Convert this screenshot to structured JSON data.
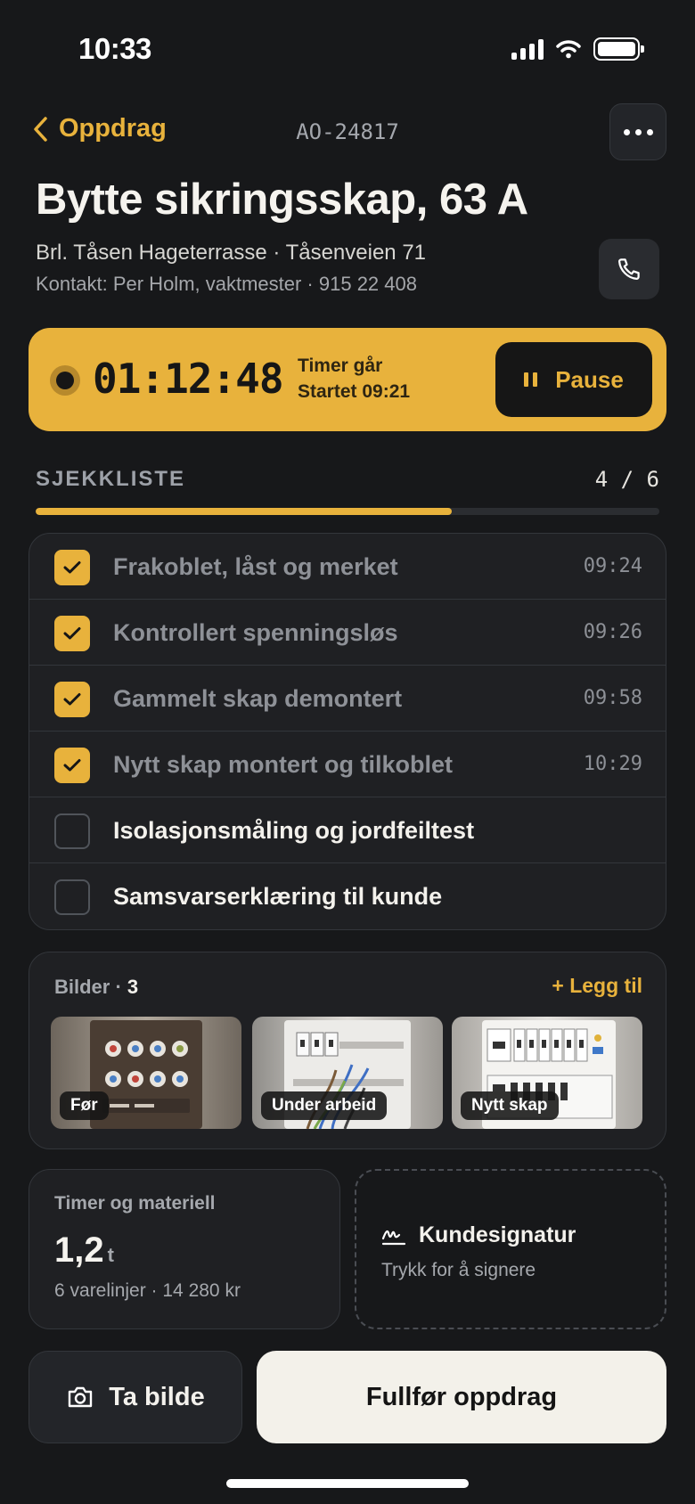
{
  "status_bar": {
    "time": "10:33"
  },
  "nav": {
    "back_label": "Oppdrag",
    "job_id": "AO-24817"
  },
  "job": {
    "title": "Bytte sikringsskap, 63 A",
    "address": "Brl. Tåsen Hageterrasse · Tåsenveien 71",
    "contact": "Kontakt: Per Holm, vaktmester · 915 22 408"
  },
  "timer": {
    "elapsed": "01:12:48",
    "status": "Timer går",
    "started": "Startet 09:21",
    "pause_label": "Pause"
  },
  "checklist": {
    "section_label": "SJEKKLISTE",
    "progress_text": "4 / 6",
    "completed": 4,
    "total": 6,
    "items": [
      {
        "label": "Frakoblet, låst og merket",
        "time": "09:24",
        "done": true
      },
      {
        "label": "Kontrollert spenningsløs",
        "time": "09:26",
        "done": true
      },
      {
        "label": "Gammelt skap demontert",
        "time": "09:58",
        "done": true
      },
      {
        "label": "Nytt skap montert og tilkoblet",
        "time": "10:29",
        "done": true
      },
      {
        "label": "Isolasjonsmåling og jordfeiltest",
        "time": "",
        "done": false
      },
      {
        "label": "Samsvarserklæring til kunde",
        "time": "",
        "done": false
      }
    ]
  },
  "photos": {
    "title": "Bilder ·",
    "count": "3",
    "add_label": "Legg til",
    "items": [
      {
        "tag": "Før"
      },
      {
        "tag": "Under arbeid"
      },
      {
        "tag": "Nytt skap"
      }
    ]
  },
  "materials": {
    "title": "Timer og materiell",
    "hours": "1,2",
    "unit": "t",
    "summary": "6 varelinjer · 14 280 kr"
  },
  "signature": {
    "title": "Kundesignatur",
    "hint": "Trykk for å signere"
  },
  "actions": {
    "camera_label": "Ta bilde",
    "finish_label": "Fullfør oppdrag"
  },
  "colors": {
    "accent": "#e8b23c",
    "background": "#17181a",
    "card": "#1f2023",
    "finish_button": "#f3f1ea"
  },
  "icons": [
    "chevron-left-icon",
    "more-icon",
    "phone-icon",
    "record-icon",
    "pause-icon",
    "check-icon",
    "plus-icon",
    "signature-icon",
    "camera-icon"
  ]
}
